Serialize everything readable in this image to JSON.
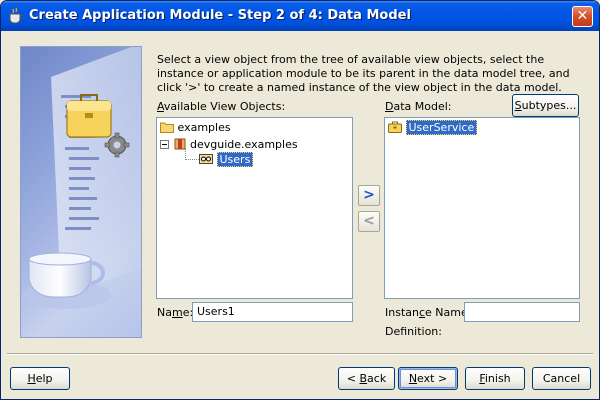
{
  "window": {
    "title": "Create Application Module - Step 2 of 4: Data Model",
    "close_glyph": "✕"
  },
  "instructions": "Select a view object from the tree of available view objects, select the instance or application module to be its parent in the data model tree, and click '>' to create a named instance of the view object in the data model.",
  "available": {
    "label_prefix": "",
    "label_access": "A",
    "label_rest": "vailable View Objects:",
    "tree": [
      {
        "label": "examples",
        "icon": "folder-icon"
      },
      {
        "label": "devguide.examples",
        "icon": "package-icon"
      },
      {
        "label": "Users",
        "icon": "view-object-icon",
        "selected": true
      }
    ]
  },
  "data_model": {
    "label_access": "D",
    "label_rest": "ata Model:",
    "subtypes_access": "S",
    "subtypes_rest": "ubtypes...",
    "tree": [
      {
        "label": "UserService",
        "icon": "application-module-icon",
        "selected": true
      }
    ]
  },
  "arrows": {
    "add": ">",
    "remove": "<"
  },
  "name_field": {
    "label_rest": "Na",
    "label_access": "m",
    "label_end": "e:",
    "value": "Users1"
  },
  "instance_field": {
    "label_start": "Instan",
    "label_access": "c",
    "label_end": "e Name:",
    "value": ""
  },
  "definition": {
    "label": "Definition:"
  },
  "buttons": {
    "help": {
      "access": "H",
      "rest": "elp"
    },
    "back": {
      "prefix": "< ",
      "access": "B",
      "rest": "ack"
    },
    "next": {
      "access": "N",
      "rest": "ext >"
    },
    "finish": {
      "access": "F",
      "rest": "inish"
    },
    "cancel": "Cancel"
  },
  "colors": {
    "titlebar": "#0055e5",
    "selection": "#316ac5",
    "dialog_bg": "#ece9d8"
  }
}
